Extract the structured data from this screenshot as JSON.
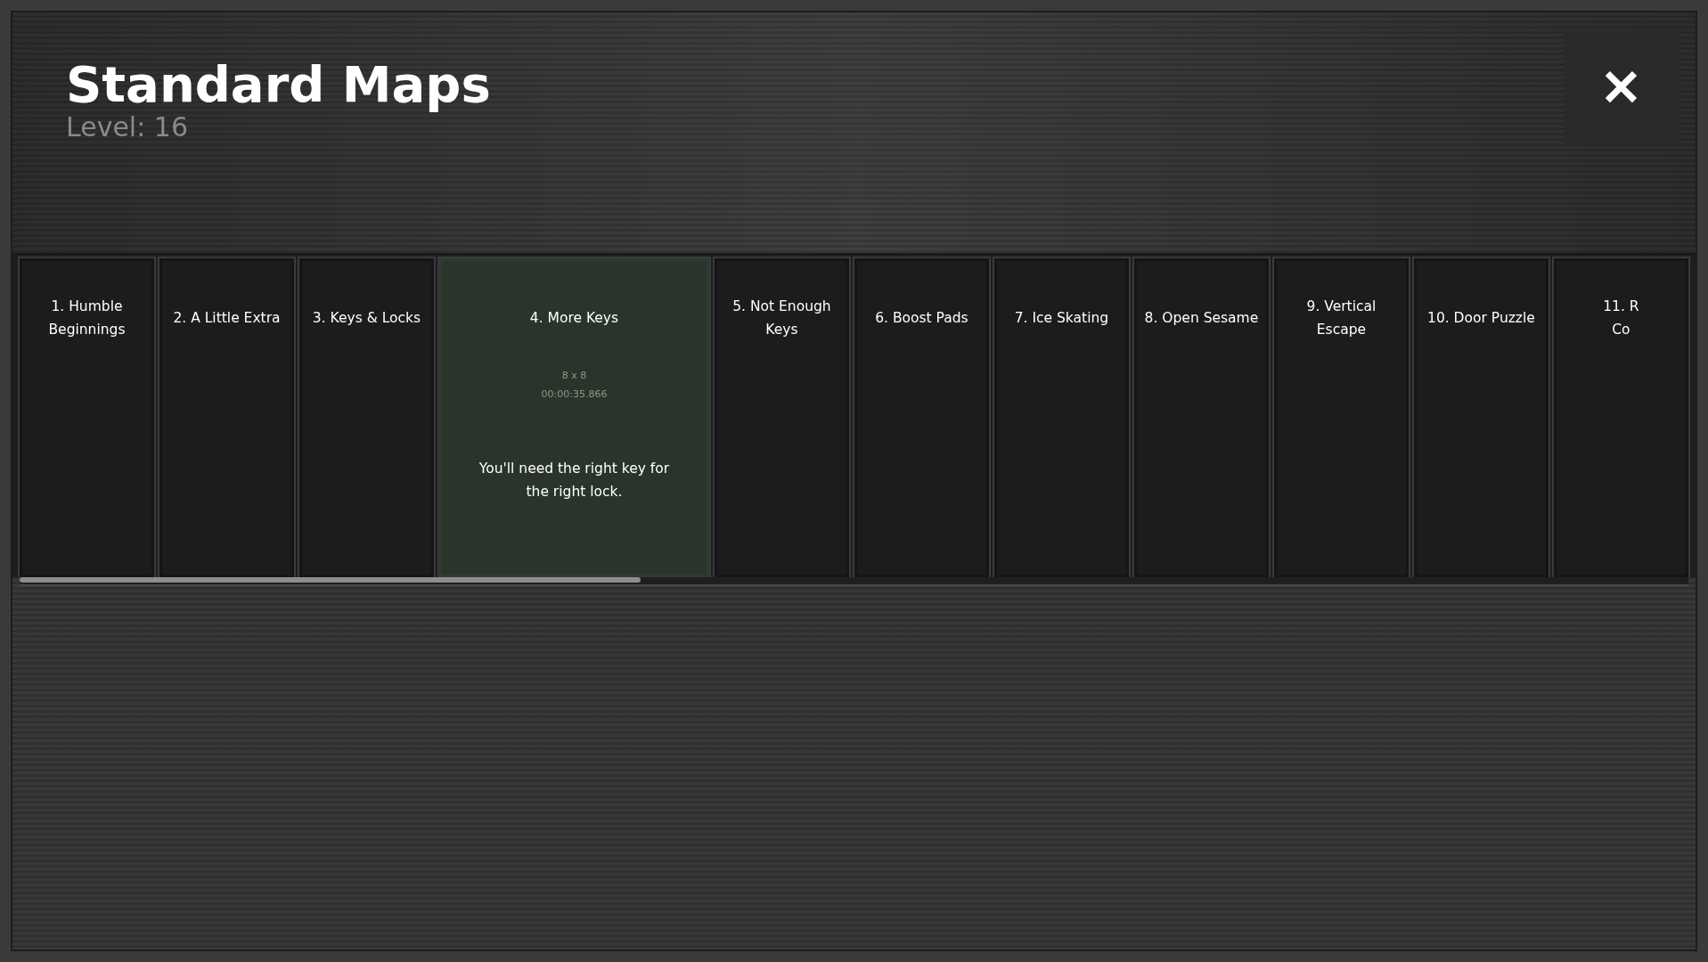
{
  "header": {
    "title": "Standard Maps",
    "subtitle": "Level: 16"
  },
  "close_button": {
    "label": "✕"
  },
  "maps": [
    {
      "title": "1. Humble Beginnings",
      "selected": false
    },
    {
      "title": "2. A Little Extra",
      "selected": false
    },
    {
      "title": "3. Keys & Locks",
      "selected": false
    },
    {
      "title": "4. More Keys",
      "selected": true,
      "size": "8 x 8",
      "best_time": "00:00:35.866",
      "description": "You'll need the right key for the right lock."
    },
    {
      "title": "5. Not Enough Keys",
      "selected": false
    },
    {
      "title": "6. Boost Pads",
      "selected": false
    },
    {
      "title": "7. Ice Skating",
      "selected": false
    },
    {
      "title": "8. Open Sesame",
      "selected": false
    },
    {
      "title": "9. Vertical Escape",
      "selected": false
    },
    {
      "title": "10. Door Puzzle",
      "selected": false
    },
    {
      "title": "11. R\nCo",
      "selected": false
    }
  ]
}
